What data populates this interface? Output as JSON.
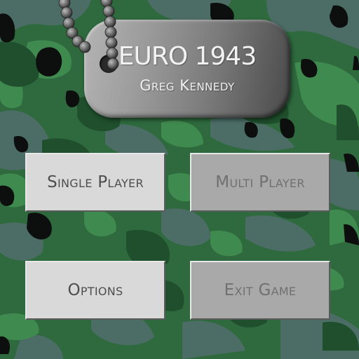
{
  "game": {
    "title": "EURO 1943",
    "author": "Greg Kennedy"
  },
  "menu": {
    "single_player": "Single Player",
    "multi_player": "Multi Player",
    "options": "Options",
    "exit_game": "Exit Game"
  },
  "menu_state": {
    "single_player": "enabled",
    "multi_player": "disabled",
    "options": "enabled",
    "exit_game": "disabled"
  },
  "colors": {
    "camo_base": "#2f6a3e",
    "camo_dark_green": "#1f4f2c",
    "camo_light_green": "#3f8a4e",
    "camo_grey": "#4c6d66",
    "camo_black": "#0c0f0d",
    "button_enabled": "#d9d9d9",
    "button_disabled": "#a9a9a9"
  }
}
